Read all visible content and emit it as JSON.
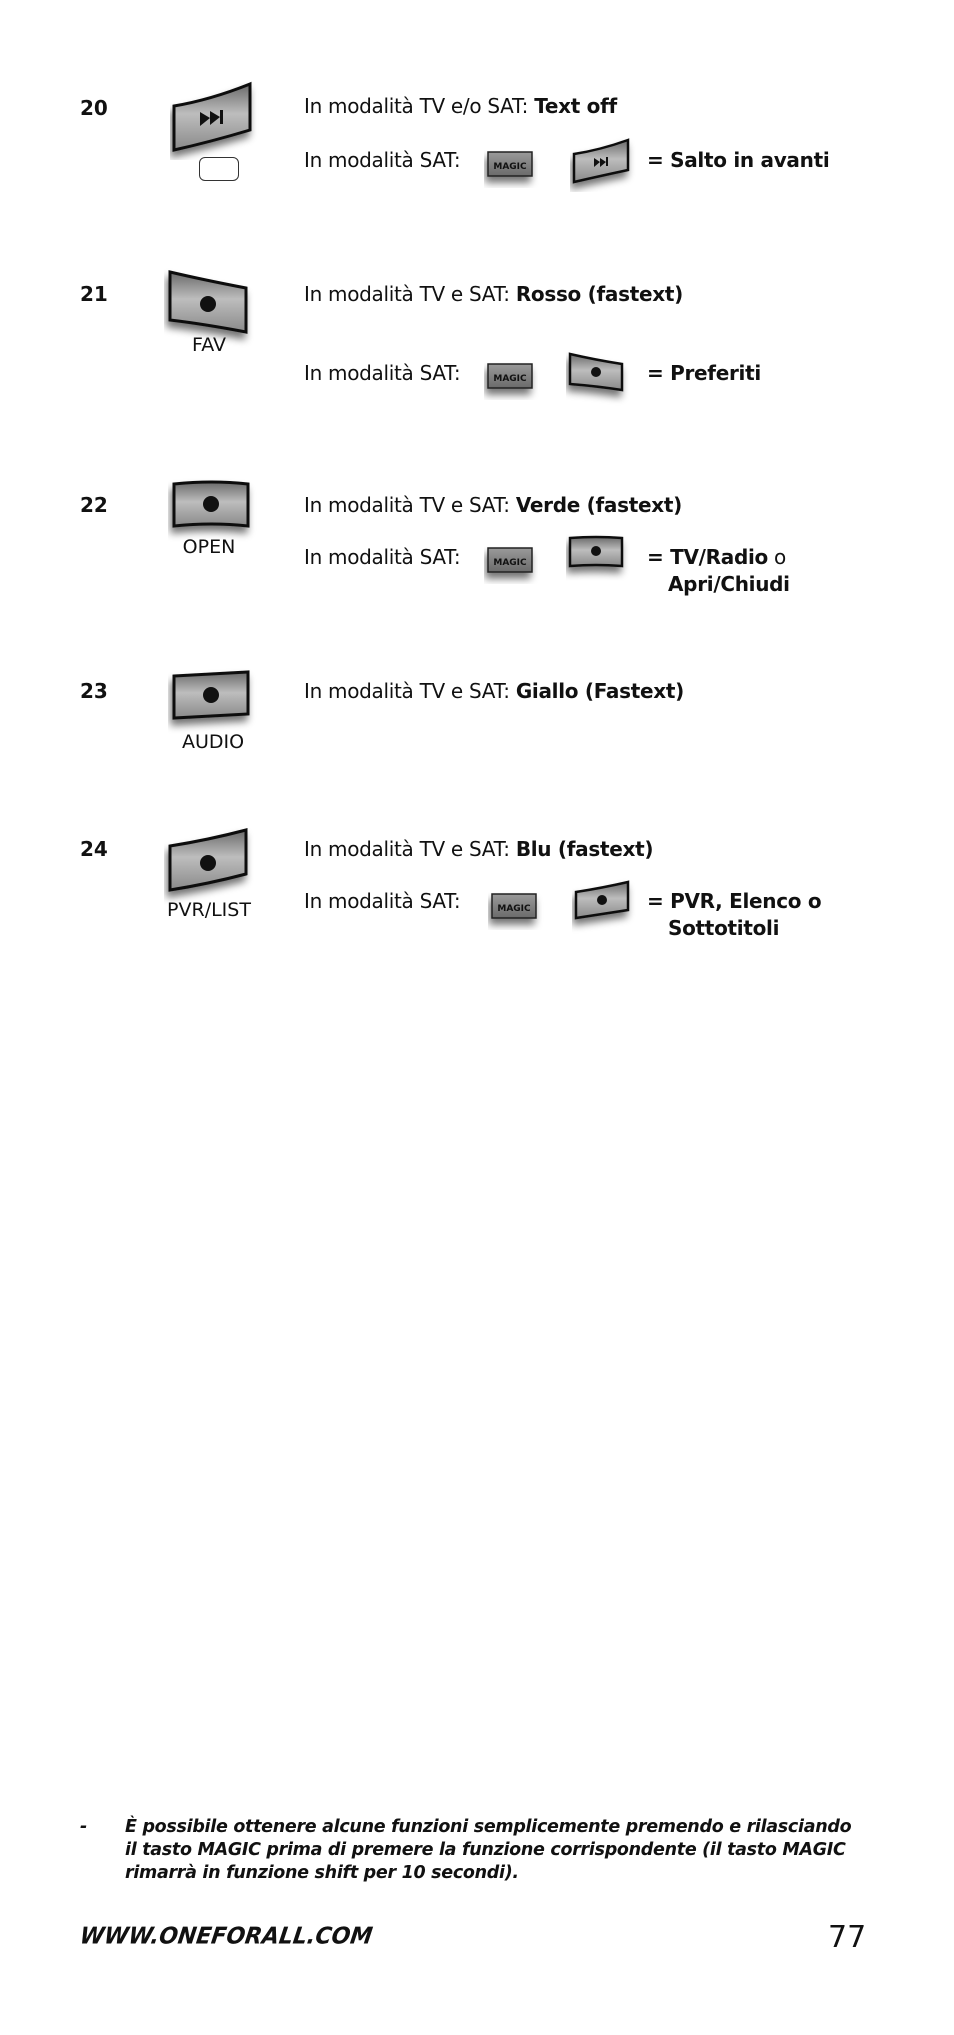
{
  "rows": [
    {
      "number": "20",
      "key_icon": "fast-forward-icon",
      "key_label": "",
      "line1_prefix": "In modalità TV  e/o SAT: ",
      "line1_bold": "Text off",
      "line2_prefix": "In modalità SAT:",
      "magic_label": "MAGIC",
      "result_bold": "= Salto in avanti",
      "result_plain": "",
      "result_line2": ""
    },
    {
      "number": "21",
      "key_icon": "dot-icon",
      "key_label": "FAV",
      "line1_prefix": "In modalità TV  e SAT: ",
      "line1_bold": "Rosso (fastext)",
      "line2_prefix": "In modalità SAT:",
      "magic_label": "MAGIC",
      "result_bold": "= Preferiti",
      "result_plain": "",
      "result_line2": ""
    },
    {
      "number": "22",
      "key_icon": "dot-icon",
      "key_label": "OPEN",
      "line1_prefix": "In modalità TV  e SAT: ",
      "line1_bold": "Verde (fastext)",
      "line2_prefix": "In modalità SAT:",
      "magic_label": "MAGIC",
      "result_bold": "= TV/Radio",
      "result_plain": " o",
      "result_line2": "Apri/Chiudi"
    },
    {
      "number": "23",
      "key_icon": "dot-icon",
      "key_label": "AUDIO",
      "line1_prefix": "In modalità TV  e SAT: ",
      "line1_bold": "Giallo (Fastext)"
    },
    {
      "number": "24",
      "key_icon": "dot-icon",
      "key_label": "PVR/LIST",
      "line1_prefix": "In modalità TV  e SAT: ",
      "line1_bold": "Blu (fastext)",
      "line2_prefix": "In modalità SAT:",
      "magic_label": "MAGIC",
      "result_bold": "= PVR, Elenco o",
      "result_plain": "",
      "result_line2": "Sottotitoli"
    }
  ],
  "note": {
    "bullet": "-",
    "lines": [
      "È possibile ottenere alcune funzioni semplicemente premendo e rilasciando",
      "il tasto MAGIC prima di premere la funzione corrispondente (il tasto MAGIC",
      "rimarrà in funzione shift per 10 secondi)."
    ]
  },
  "footer": {
    "url": "WWW.ONEFORALL.COM",
    "page_number": "77"
  }
}
